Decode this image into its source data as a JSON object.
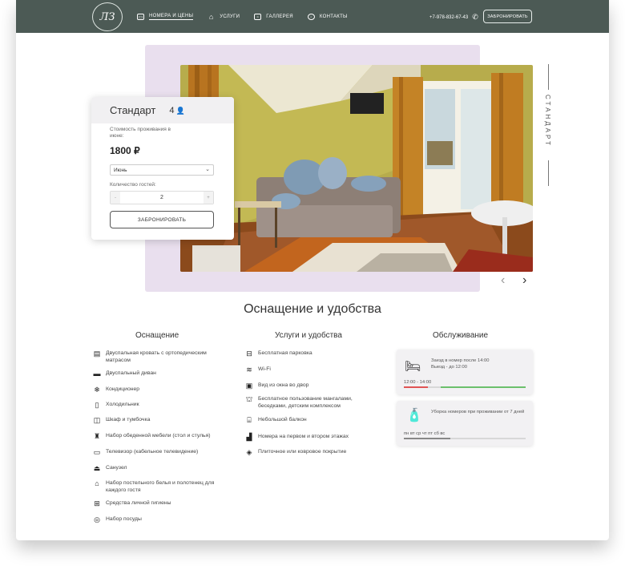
{
  "header": {
    "logo_text": "ЛЗ",
    "nav": [
      {
        "label": "НОМЕРА И ЦЕНЫ",
        "icon": "bed-icon",
        "active": true
      },
      {
        "label": "УСЛУГИ",
        "icon": "home-icon",
        "active": false
      },
      {
        "label": "ГАЛЛЕРЕЯ",
        "icon": "image-icon",
        "active": false
      },
      {
        "label": "КОНТАКТЫ",
        "icon": "compass-icon",
        "active": false
      }
    ],
    "phone": "+7-978-832-67-43",
    "book_label": "ЗАБРОНИРОВАТЬ"
  },
  "room": {
    "vertical_label": "СТАНДАРТ",
    "title": "Стандарт",
    "guests_count": "4",
    "stay_label": "Стоимость проживания в июне:",
    "price": "1800 ₽",
    "month_select": "Июнь",
    "guests_label": "Количество гостей:",
    "minus": "-",
    "plus": "+",
    "guests_value": "2",
    "book_label": "ЗАБРОНИРОВАТЬ"
  },
  "amenities": {
    "title": "Оснащение и удобства",
    "equipment": {
      "title": "Оснащение",
      "items": [
        "Двуспальная кровать с ортопедическим матрасом",
        "Двуспальный диван",
        "Кондиционер",
        "Холодильник",
        "Шкаф и тумбочка",
        "Набор обеденной мебели (стол и стулья)",
        "Телевизор (кабельное телевидение)",
        "Санузел",
        "Набор постельного белья и полотенец для каждого гостя",
        "Средства личной гигиены",
        "Набор посуды"
      ]
    },
    "services": {
      "title": "Услуги и удобства",
      "items": [
        "Бесплатная парковка",
        "Wi-Fi",
        "Вид из окна во двор",
        "Бесплатное пользование мангалами, беседками, детским комплексом",
        "Небольшой балкон",
        "Номера на первом и втором этажах",
        "Плиточное или ковровое покрытие"
      ]
    },
    "service": {
      "title": "Обслуживание",
      "checkin_line1": "Заезд в номер после 14:00",
      "checkin_line2": "Выезд - до 12:00",
      "checkin_range": "12:00 - 14:00",
      "cleaning_text": "Уборка номеров при проживании от 7 дней",
      "days": "пн вт ср чт пт сб вс"
    }
  },
  "colors": {
    "header_bg": "#4c5a55",
    "accent_purple": "#e9dfee",
    "bar_red": "#e05454",
    "bar_green": "#6cc06c",
    "bar_dark": "#888888"
  }
}
